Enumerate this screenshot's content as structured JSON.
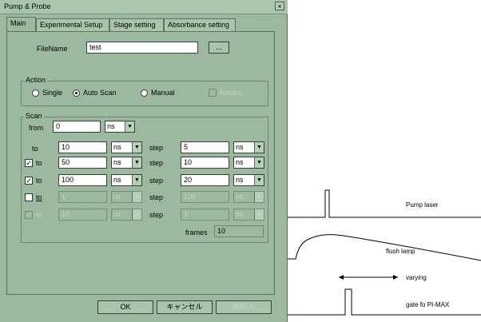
{
  "window": {
    "title": "Pump & Probe",
    "close": "×"
  },
  "tabs": [
    {
      "label": "Main"
    },
    {
      "label": "Experimental Setup"
    },
    {
      "label": "Stage setting"
    },
    {
      "label": "Absorbance setting"
    }
  ],
  "file": {
    "label": "FileName",
    "value": "test",
    "browse": "..."
  },
  "action": {
    "group_label": "Action",
    "single": "Single",
    "auto_scan": "Auto Scan",
    "manual": "Manual",
    "autoinc": "AutoInc",
    "selected": "auto_scan"
  },
  "scan": {
    "group_label": "Scan",
    "from_label": "from",
    "from_value": "0",
    "from_unit": "ns",
    "to_label": "to",
    "step_label": "step",
    "rows": [
      {
        "to": "10",
        "to_unit": "ns",
        "step": "5",
        "step_unit": "ns",
        "checked": null,
        "enabled": true
      },
      {
        "to": "50",
        "to_unit": "ns",
        "step": "10",
        "step_unit": "ns",
        "checked": true,
        "enabled": true
      },
      {
        "to": "100",
        "to_unit": "ns",
        "step": "20",
        "step_unit": "ns",
        "checked": true,
        "enabled": true
      },
      {
        "to": "1",
        "to_unit": "ns",
        "step": "100",
        "step_unit": "ns",
        "checked": false,
        "enabled": false
      },
      {
        "to": "10",
        "to_unit": "ns",
        "step": "1",
        "step_unit": "ns",
        "checked": true,
        "enabled": false
      }
    ],
    "frames_label": "frames",
    "frames_value": "10"
  },
  "buttons": {
    "ok": "OK",
    "cancel": "キャンセル",
    "apply": "適用(A)"
  },
  "diagram": {
    "pump": "Pump laser",
    "flush": "flush lamp",
    "varying": "varying",
    "gate": "gate fo PI-MAX"
  },
  "colors": {
    "window_bg": "#9cb89e",
    "titlebar": "#a9c4ab",
    "disabled_text": "#c6d7c7"
  }
}
